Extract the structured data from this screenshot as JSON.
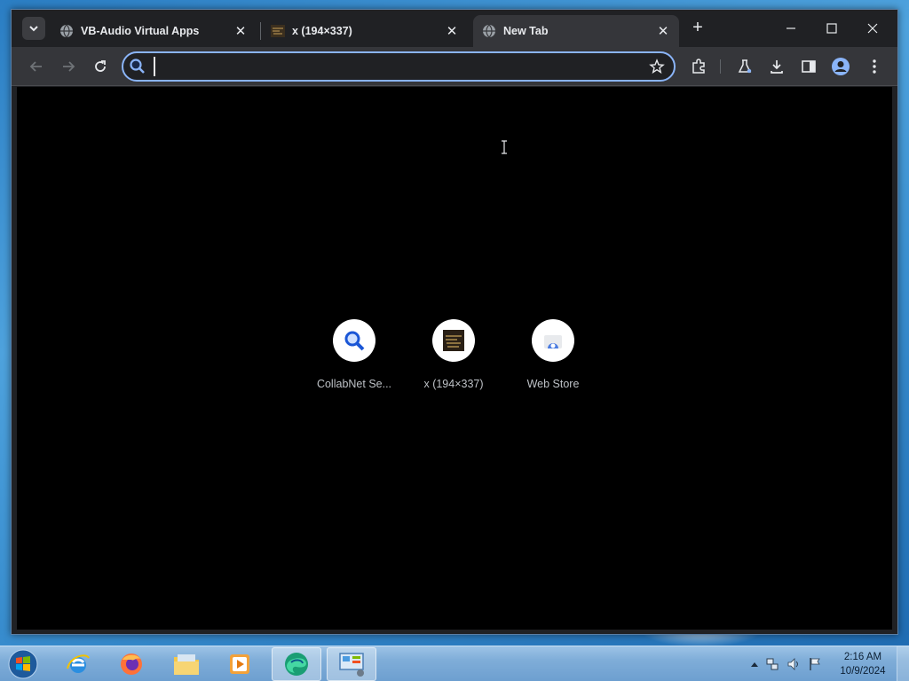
{
  "tabs": [
    {
      "title": "VB-Audio Virtual Apps",
      "favicon": "globe-icon",
      "active": false
    },
    {
      "title": "x (194×337)",
      "favicon": "image-thumb-icon",
      "active": false
    },
    {
      "title": "New Tab",
      "favicon": "globe-icon",
      "active": true
    }
  ],
  "omnibox": {
    "value": "",
    "placeholder": ""
  },
  "shortcuts": [
    {
      "label": "CollabNet Se...",
      "icon": "search-magnifier-icon"
    },
    {
      "label": "x (194×337)",
      "icon": "image-thumb-icon"
    },
    {
      "label": "Web Store",
      "icon": "web-store-icon"
    }
  ],
  "taskbar": {
    "apps": [
      "internet-explorer-icon",
      "firefox-icon",
      "file-explorer-icon",
      "media-player-icon",
      "edge-icon",
      "control-panel-icon"
    ]
  },
  "clock": {
    "time": "2:16 AM",
    "date": "10/9/2024"
  },
  "colors": {
    "content_bg": "#000000",
    "accent": "#8ab4f8",
    "tabstrip": "#202124",
    "toolbar": "#35363a"
  }
}
